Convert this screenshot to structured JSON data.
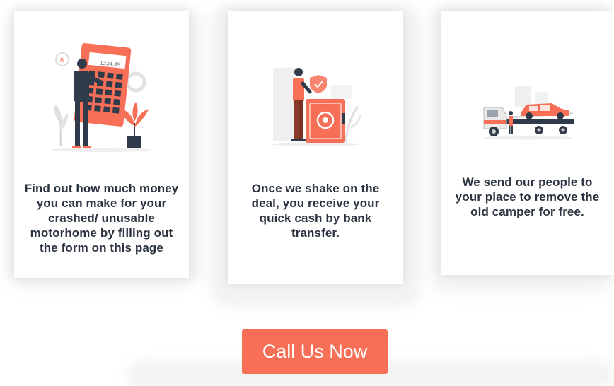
{
  "steps": [
    {
      "text": "Find out how much money you can make for your crashed/ unusable motorhome by filling out the form on this page",
      "icon": "calculator-illustration",
      "calculator_display": "1234,45"
    },
    {
      "text": "Once we shake on the deal, you receive your quick cash by bank transfer.",
      "icon": "safe-illustration"
    },
    {
      "text": "We send our people to your place to remove the old camper for free.",
      "icon": "tow-truck-illustration"
    }
  ],
  "cta": {
    "label": "Call Us Now"
  },
  "colors": {
    "accent": "#f76f56",
    "text": "#2b3440",
    "dark": "#2f3b4a"
  }
}
